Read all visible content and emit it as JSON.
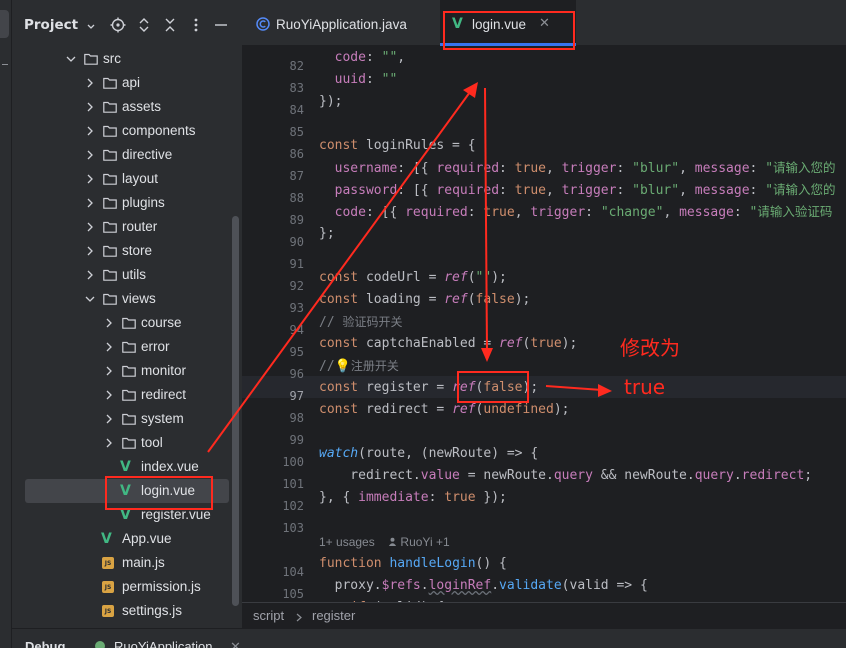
{
  "project_panel": {
    "title": "Project",
    "tree": [
      {
        "label": "src",
        "kind": "folder",
        "expanded": true
      },
      {
        "label": "api",
        "kind": "folder"
      },
      {
        "label": "assets",
        "kind": "folder"
      },
      {
        "label": "components",
        "kind": "folder"
      },
      {
        "label": "directive",
        "kind": "folder"
      },
      {
        "label": "layout",
        "kind": "folder"
      },
      {
        "label": "plugins",
        "kind": "folder"
      },
      {
        "label": "router",
        "kind": "folder"
      },
      {
        "label": "store",
        "kind": "folder"
      },
      {
        "label": "utils",
        "kind": "folder"
      },
      {
        "label": "views",
        "kind": "folder",
        "expanded": true
      },
      {
        "label": "course",
        "kind": "folder"
      },
      {
        "label": "error",
        "kind": "folder"
      },
      {
        "label": "monitor",
        "kind": "folder"
      },
      {
        "label": "redirect",
        "kind": "folder"
      },
      {
        "label": "system",
        "kind": "folder"
      },
      {
        "label": "tool",
        "kind": "folder"
      },
      {
        "label": "index.vue",
        "kind": "vue"
      },
      {
        "label": "login.vue",
        "kind": "vue",
        "selected": true
      },
      {
        "label": "register.vue",
        "kind": "vue"
      },
      {
        "label": "App.vue",
        "kind": "vue"
      },
      {
        "label": "main.js",
        "kind": "js"
      },
      {
        "label": "permission.js",
        "kind": "js"
      },
      {
        "label": "settings.js",
        "kind": "js"
      }
    ]
  },
  "tabs": [
    {
      "label": "RuoYiApplication.java",
      "icon": "java-class-icon",
      "active": false
    },
    {
      "label": "login.vue",
      "icon": "vue-icon",
      "active": true
    }
  ],
  "code": {
    "line_numbers": [
      "82",
      "83",
      "84",
      "85",
      "86",
      "87",
      "88",
      "89",
      "90",
      "91",
      "92",
      "93",
      "94",
      "95",
      "96",
      "97",
      "98",
      "99",
      "100",
      "101",
      "102",
      "103",
      "104",
      "105"
    ],
    "current_line": "97",
    "inlay_hint": {
      "usages": "1+ usages",
      "author": "RuoYi +1"
    }
  },
  "breadcrumbs": [
    "script",
    "register"
  ],
  "bottom_bar": {
    "debug_label": "Debug",
    "config_label": "RuoYiApplication"
  },
  "annotations": {
    "label_modify": "修改为",
    "label_true": "true"
  },
  "colors": {
    "annotation_red": "#ff2a1f",
    "accent_blue": "#3574f0",
    "vue_green": "#41b883"
  }
}
